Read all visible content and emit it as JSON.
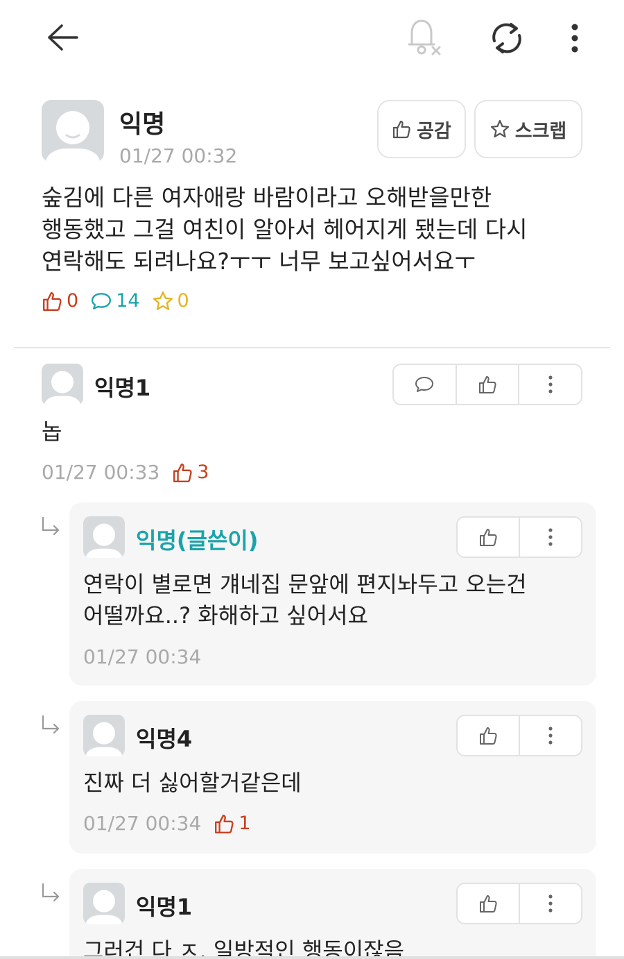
{
  "post": {
    "author": "익명",
    "time": "01/27 00:32",
    "like_label": "공감",
    "scrap_label": "스크랩",
    "body_lines": [
      "숲김에 다른 여자애랑 바람이라고 오해받을만한",
      "행동했고 그걸 여친이 알아서 헤어지게 됐는데 다시",
      "연락해도 되려나요?ㅜㅜ 너무 보고싶어서요ㅜ"
    ],
    "likes": "0",
    "comments": "14",
    "scraps": "0"
  },
  "comments": [
    {
      "author": "익명1",
      "text": "놉",
      "time": "01/27 00:33",
      "likes": "3",
      "replies": [
        {
          "author": "익명(글쓴이)",
          "is_op": true,
          "text_lines": [
            "연락이 별로면 걔네집 문앞에 편지놔두고 오는건",
            "어떨까요..? 화해하고 싶어서요"
          ],
          "time": "01/27 00:34",
          "likes": ""
        },
        {
          "author": "익명4",
          "is_op": false,
          "text_lines": [
            "진짜 더 싫어할거같은데"
          ],
          "time": "01/27 00:34",
          "likes": "1"
        },
        {
          "author": "익명1",
          "is_op": false,
          "text_lines": [
            "그러건 다 ㅈ. 일방적인 행동이잖음"
          ],
          "time": "",
          "likes": ""
        }
      ]
    }
  ],
  "colors": {
    "like": "#c6401f",
    "comment": "#1aa3aa",
    "scrap": "#e6b420",
    "op_name": "#1aa3aa",
    "timestamp": "#a9a9a9"
  },
  "icons": {
    "back": "arrow-left-icon",
    "notification": "bell-off-icon",
    "refresh": "refresh-icon",
    "more": "more-vertical-icon"
  }
}
